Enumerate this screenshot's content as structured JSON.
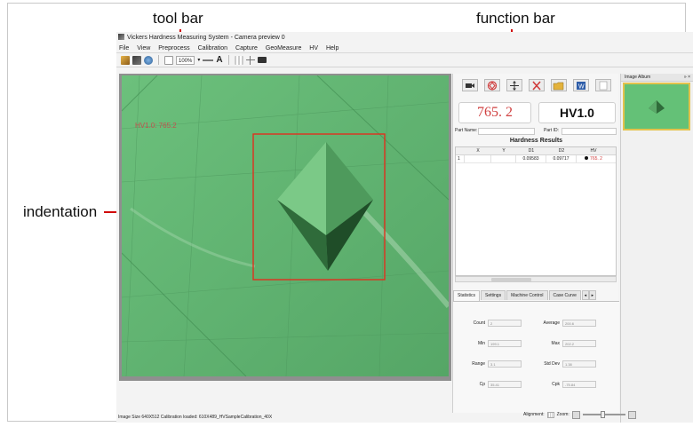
{
  "annotations": {
    "tool_bar": "tool bar",
    "function_bar": "function bar",
    "indentation": "indentation"
  },
  "window": {
    "title": "Vickers Hardness Measuring System - Camera preview 0"
  },
  "menu": [
    "File",
    "View",
    "Preprocess",
    "Calibration",
    "Capture",
    "GeoMeasure",
    "HV",
    "Help"
  ],
  "toolbar": {
    "zoom": "100%",
    "text_tool": "A"
  },
  "camera": {
    "overlay_text": "HV1.0: 765.2"
  },
  "readout": {
    "value": "765. 2",
    "scale": "HV1.0"
  },
  "part": {
    "name_label": "Part Name:",
    "id_label": "Part ID:",
    "name_value": "",
    "id_value": ""
  },
  "results": {
    "title": "Hardness Results",
    "headers": [
      "",
      "X",
      "Y",
      "D1",
      "D2",
      "HV"
    ],
    "rows": [
      [
        "1",
        "",
        "",
        "0.09583",
        "0.09717",
        "765. 2"
      ]
    ]
  },
  "stat_tabs": [
    "Statistics",
    "Settings",
    "Machine Control",
    "Case Curve"
  ],
  "statistics": {
    "count_label": "Count",
    "count_value": "2",
    "average_label": "Average",
    "average_value": "200.6",
    "min_label": "Min",
    "min_value": "199.1",
    "max_label": "Max",
    "max_value": "202.2",
    "range_label": "Range",
    "range_value": "3.1",
    "stddev_label": "Std Dev",
    "stddev_value": "1.38",
    "cp_label": "Cp",
    "cp_value": "35.41",
    "cpk_label": "Cpk",
    "cpk_value": "-75.84"
  },
  "album": {
    "title": "Image Album",
    "controls": "» ×"
  },
  "status": {
    "left": "Image Size 640X512  Calibration loaded: 610X489_HVSampleCalibration_40X",
    "alignment_label": "Alignment:",
    "zoom_label": "Zoom:"
  },
  "colors": {
    "accent_red": "#d00000",
    "camera_green": "#63b273",
    "hv_red": "#d04040"
  }
}
